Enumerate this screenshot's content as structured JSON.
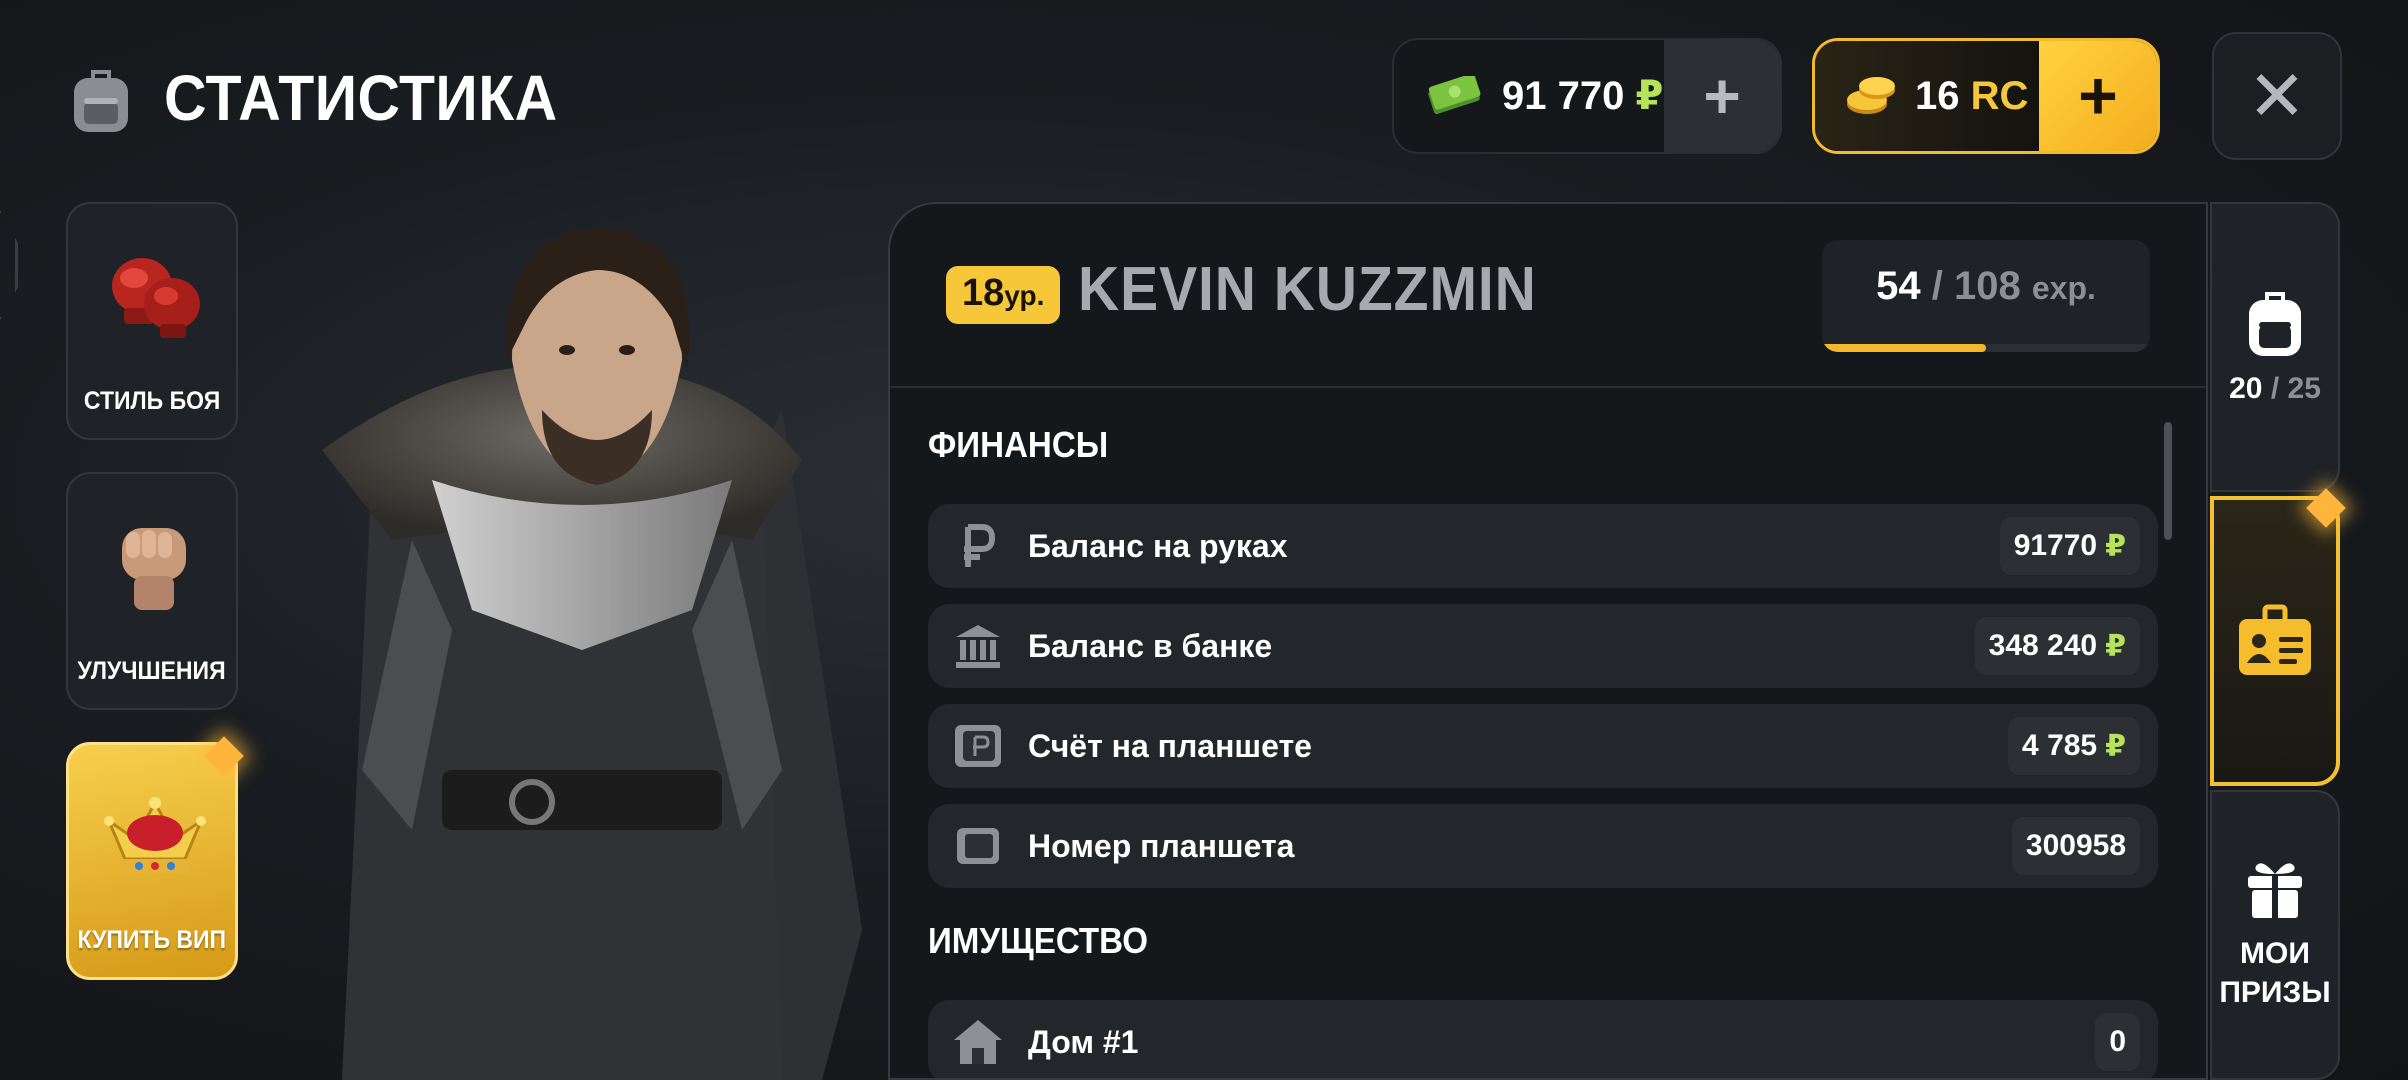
{
  "header": {
    "title": "СТАТИСТИКА",
    "title_icon": "backpack-icon",
    "money": {
      "amount": "91 770",
      "currency": "₽",
      "icon": "cash-icon",
      "add_label": "+"
    },
    "rc": {
      "amount": "16",
      "currency": "RC",
      "icon": "coins-icon",
      "add_label": "+"
    },
    "close_label": "✕"
  },
  "side_menu": {
    "fight_style": {
      "label": "СТИЛЬ БОЯ",
      "icon": "boxing-gloves-icon"
    },
    "upgrades": {
      "label": "УЛУЧШЕНИЯ",
      "icon": "fist-icon"
    },
    "buy_vip": {
      "label": "КУПИТЬ ВИП",
      "icon": "crown-icon"
    }
  },
  "player": {
    "level": "18",
    "level_suffix": "ур.",
    "name": "KEVIN KUZZMIN",
    "exp_current": "54",
    "exp_sep": "/",
    "exp_max": "108",
    "exp_unit": "exp.",
    "exp_progress": 0.5
  },
  "finance": {
    "title": "ФИНАНСЫ",
    "rows": [
      {
        "label": "Баланс на руках",
        "value": "91770",
        "currency": "₽",
        "icon": "ruble-icon"
      },
      {
        "label": "Баланс в банке",
        "value": "348 240",
        "currency": "₽",
        "icon": "bank-icon"
      },
      {
        "label": "Счёт на планшете",
        "value": "4 785",
        "currency": "₽",
        "icon": "tablet-wallet-icon"
      },
      {
        "label": "Номер планшета",
        "value": "300958",
        "currency": "",
        "icon": "tablet-icon"
      }
    ]
  },
  "property": {
    "title": "ИМУЩЕСТВО",
    "rows": [
      {
        "label": "Дом #1",
        "value": "0",
        "icon": "house-icon"
      }
    ]
  },
  "right_tabs": {
    "inventory": {
      "current": "20",
      "sep": "/",
      "max": "25",
      "icon": "backpack-icon"
    },
    "passport": {
      "icon": "id-card-icon"
    },
    "prizes": {
      "label_line1": "МОИ",
      "label_line2": "ПРИЗЫ",
      "icon": "gift-icon"
    }
  },
  "colors": {
    "accent_gold": "#f5b82c",
    "money_green": "#b6e35a",
    "panel_bg": "#15181b"
  }
}
